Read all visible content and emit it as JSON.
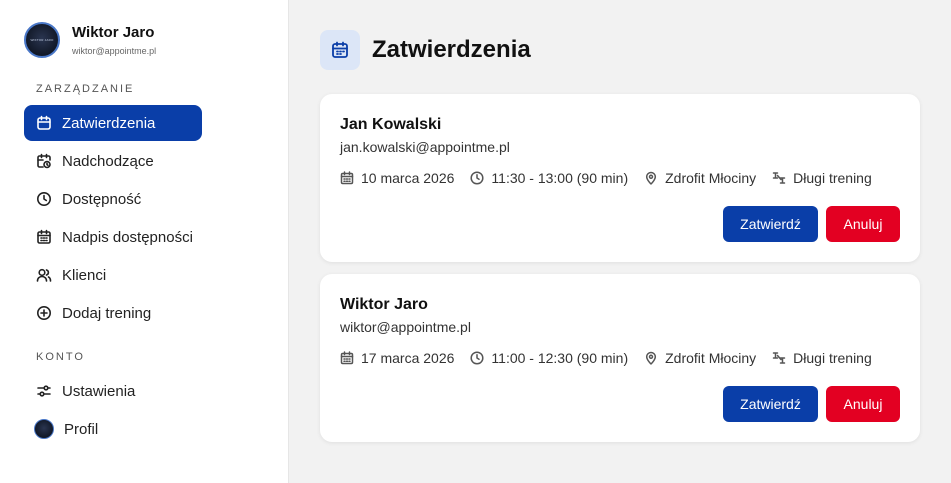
{
  "user": {
    "name": "Wiktor Jaro",
    "email": "wiktor@appointme.pl",
    "avatar_text": "WIKTOR JARO"
  },
  "sidebar": {
    "section_manage": "ZARZĄDZANIE",
    "items": [
      {
        "label": "Zatwierdzenia",
        "icon": "calendar-check-icon",
        "active": true
      },
      {
        "label": "Nadchodzące",
        "icon": "calendar-clock-icon"
      },
      {
        "label": "Dostępność",
        "icon": "clock-icon"
      },
      {
        "label": "Nadpis dostępności",
        "icon": "calendar-grid-icon"
      },
      {
        "label": "Klienci",
        "icon": "users-icon"
      },
      {
        "label": "Dodaj trening",
        "icon": "plus-circle-icon"
      }
    ],
    "section_account": "KONTO",
    "account_items": [
      {
        "label": "Ustawienia",
        "icon": "sliders-icon"
      },
      {
        "label": "Profil",
        "icon": "avatar"
      }
    ]
  },
  "main": {
    "title": "Zatwierdzenia",
    "cards": [
      {
        "name": "Jan Kowalski",
        "email": "jan.kowalski@appointme.pl",
        "date": "10 marca 2026",
        "time": "11:30 - 13:00 (90 min)",
        "location": "Zdrofit Młociny",
        "training": "Długi trening",
        "confirm_label": "Zatwierdź",
        "cancel_label": "Anuluj"
      },
      {
        "name": "Wiktor Jaro",
        "email": "wiktor@appointme.pl",
        "date": "17 marca 2026",
        "time": "11:00 - 12:30 (90 min)",
        "location": "Zdrofit Młociny",
        "training": "Długi trening",
        "confirm_label": "Zatwierdź",
        "cancel_label": "Anuluj"
      }
    ]
  },
  "colors": {
    "accent": "#0a3ea8",
    "danger": "#e30022",
    "background": "#f2f2f2"
  }
}
